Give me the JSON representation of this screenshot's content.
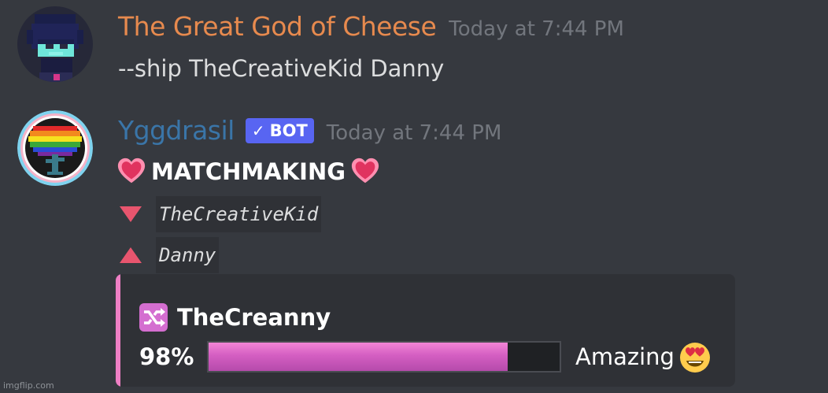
{
  "messages": [
    {
      "username": "The Great God of Cheese",
      "username_color": "#e78a4e",
      "timestamp": "Today at 7:44 PM",
      "text": "--ship TheCreativeKid Danny",
      "avatar_icon": "pixel-character-avatar"
    },
    {
      "username": "Yggdrasil",
      "username_color": "#3a75a8",
      "bot_tag": "BOT",
      "timestamp": "Today at 7:44 PM",
      "avatar_icon": "rainbow-tree-avatar",
      "title": "MATCHMAKING",
      "title_icon": "heart-icon",
      "user_down": "TheCreativeKid",
      "user_up": "Danny",
      "embed": {
        "color": "#ee7fc4",
        "title": "TheCreanny",
        "title_icon": "shuffle-icon",
        "percent_label": "98%",
        "percent": 98,
        "rating": "Amazing",
        "rating_icon": "heart-eyes-emoji"
      }
    }
  ],
  "watermark": "imgflip.com"
}
